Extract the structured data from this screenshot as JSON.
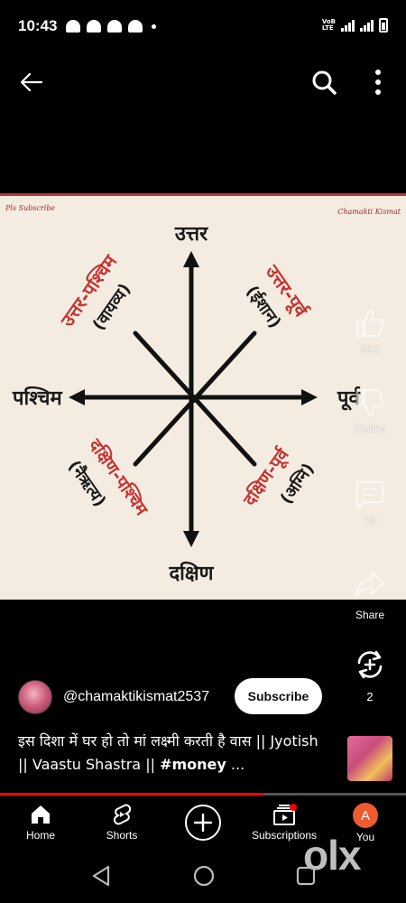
{
  "status_bar": {
    "time": "10:43",
    "network_label_top": "VoB",
    "network_label_bottom": "LTE"
  },
  "top_bar": {
    "back_icon": "arrow-left-icon",
    "search_icon": "search-icon",
    "more_icon": "more-vert-icon"
  },
  "video": {
    "watermark_left": "Pls Subscribe",
    "watermark_right": "Chamakti Kismat",
    "directions": {
      "north": "उत्तर",
      "south": "दक्षिण",
      "east": "पूर्व",
      "west": "पश्चिम",
      "northwest": "उत्तर-पश्चिम",
      "northwest_sub": "(वायव्य)",
      "northeast": "उत्तर-पूर्व",
      "northeast_sub": "(ईशान)",
      "southwest": "दक्षिण-पश्चिम",
      "southwest_sub": "(नैऋत्य)",
      "southeast": "दक्षिण-पूर्व",
      "southeast_sub": "(अग्नि)"
    }
  },
  "actions": {
    "like_count": "39K",
    "dislike_label": "Dislike",
    "comment_count": "79",
    "share_label": "Share",
    "remix_count": "2"
  },
  "channel": {
    "handle": "@chamaktikismat2537",
    "subscribe_label": "Subscribe"
  },
  "title": {
    "text": "इस दिशा में घर हो तो मां लक्ष्मी करती है वास || Jyotish || Vaastu Shastra || ",
    "hashtag": "#money",
    "ellipsis": " ..."
  },
  "progress": {
    "fraction": 0.65
  },
  "bottom_nav": {
    "home": "Home",
    "shorts": "Shorts",
    "subscriptions": "Subscriptions",
    "you": "You",
    "you_initial": "A"
  },
  "watermark": "olx",
  "colors": {
    "background": "#000000",
    "video_bg": "#f4ece0",
    "accent_red": "#ff0000",
    "direction_red": "#c63333",
    "avatar_orange": "#ef5b2e"
  }
}
